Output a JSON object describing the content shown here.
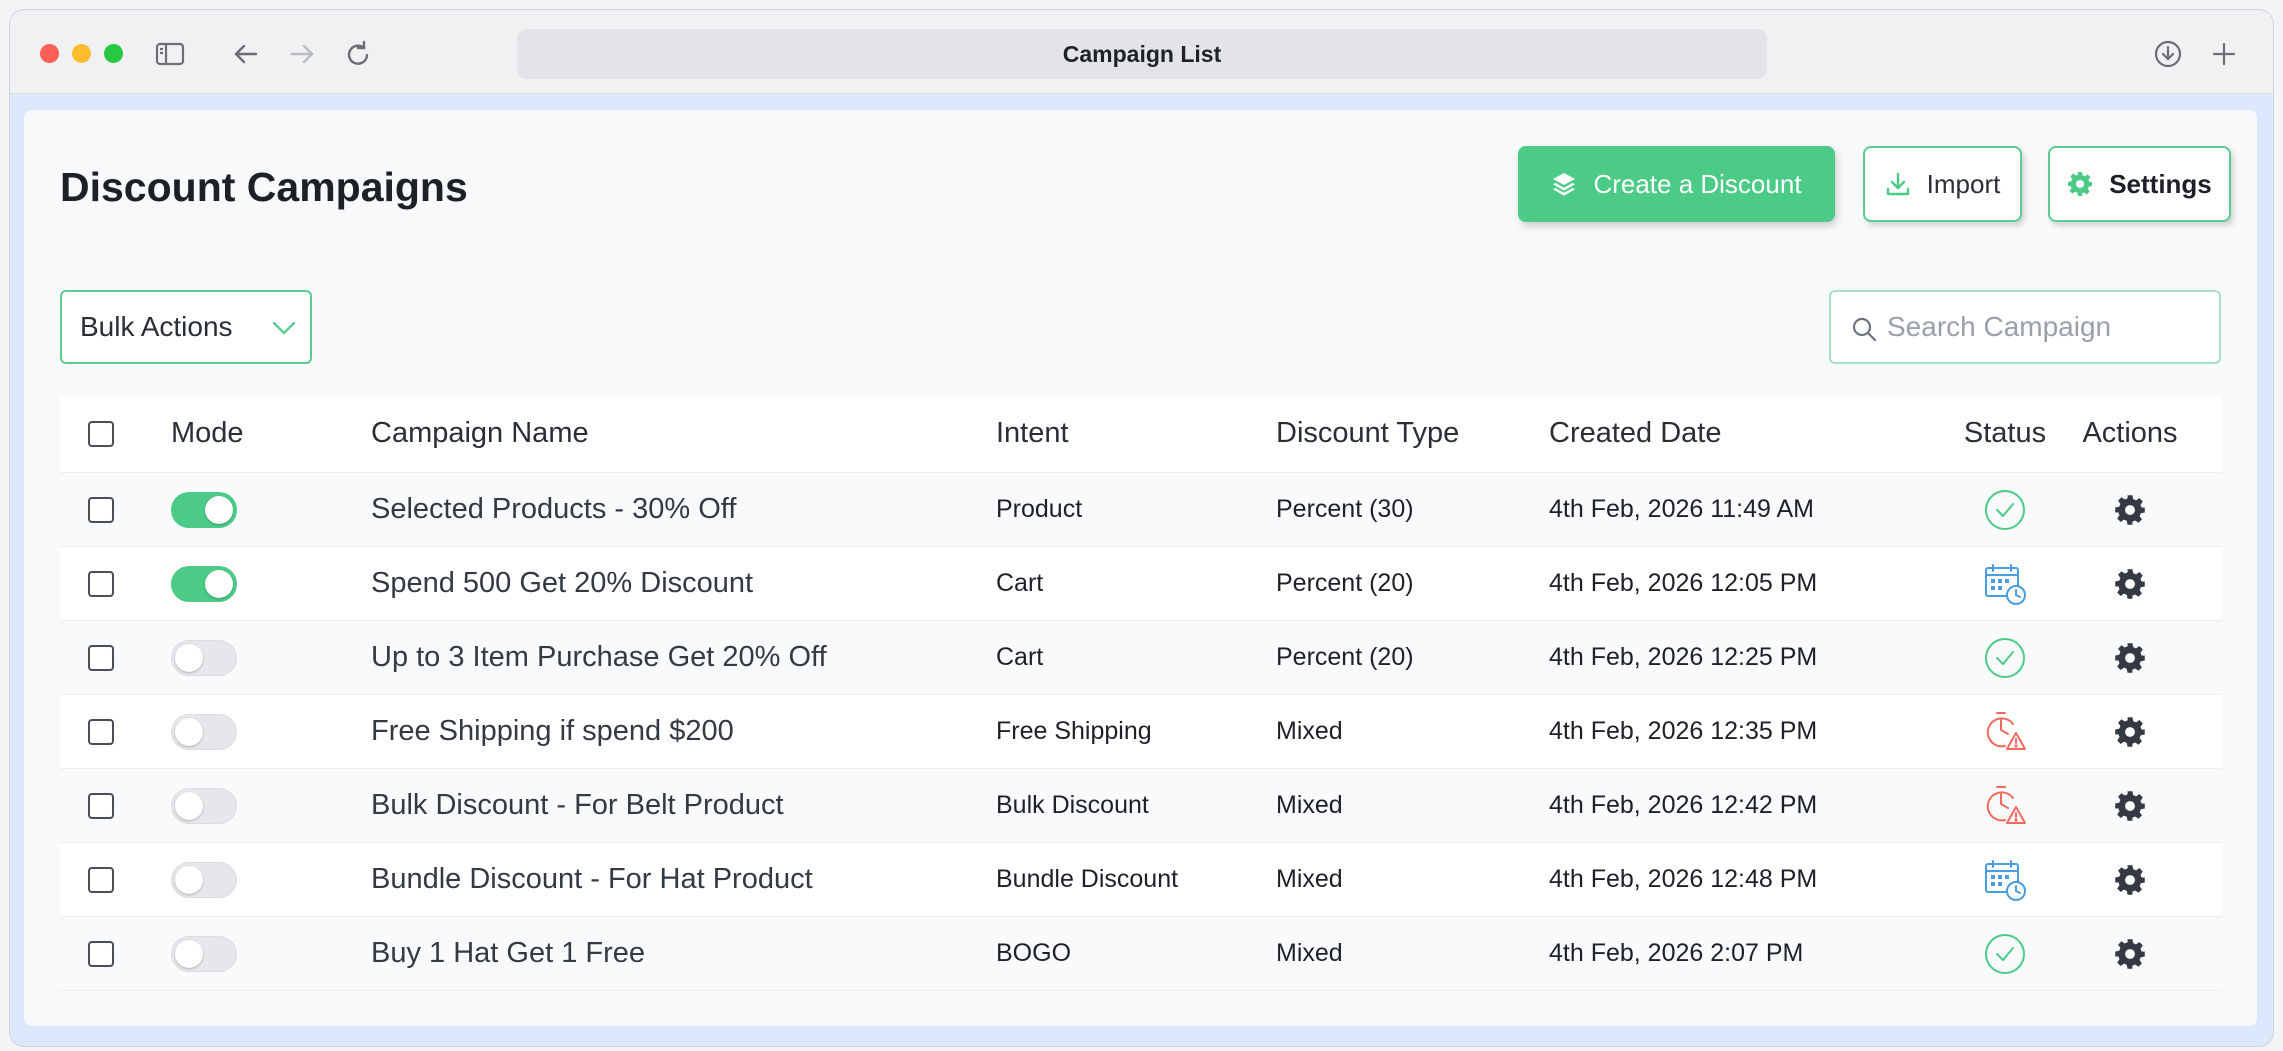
{
  "browser": {
    "title": "Campaign List"
  },
  "page": {
    "title": "Discount Campaigns",
    "buttons": {
      "create": "Create a Discount",
      "import": "Import",
      "settings": "Settings"
    },
    "bulk_actions": {
      "selected": "Bulk Actions"
    },
    "search": {
      "placeholder": "Search Campaign",
      "value": ""
    }
  },
  "table": {
    "columns": {
      "mode": "Mode",
      "name": "Campaign Name",
      "intent": "Intent",
      "discount_type": "Discount Type",
      "created_date": "Created Date",
      "status": "Status",
      "actions": "Actions"
    },
    "rows": [
      {
        "enabled": true,
        "name": "Selected Products - 30% Off",
        "intent": "Product",
        "discount_type": "Percent (30)",
        "created_date": "4th Feb, 2026 11:49 AM",
        "status": "active-check-icon"
      },
      {
        "enabled": true,
        "name": "Spend 500 Get 20% Discount",
        "intent": "Cart",
        "discount_type": "Percent (20)",
        "created_date": "4th Feb, 2026 12:05 PM",
        "status": "scheduled-calendar-icon"
      },
      {
        "enabled": false,
        "name": "Up to 3 Item Purchase Get 20% Off",
        "intent": "Cart",
        "discount_type": "Percent (20)",
        "created_date": "4th Feb, 2026 12:25 PM",
        "status": "active-check-icon"
      },
      {
        "enabled": false,
        "name": "Free Shipping if spend $200",
        "intent": "Free Shipping",
        "discount_type": "Mixed",
        "created_date": "4th Feb, 2026 12:35 PM",
        "status": "expired-clock-icon"
      },
      {
        "enabled": false,
        "name": "Bulk Discount - For Belt Product",
        "intent": "Bulk Discount",
        "discount_type": "Mixed",
        "created_date": "4th Feb, 2026 12:42 PM",
        "status": "expired-clock-icon"
      },
      {
        "enabled": false,
        "name": "Bundle Discount - For Hat Product",
        "intent": "Bundle Discount",
        "discount_type": "Mixed",
        "created_date": "4th Feb, 2026 12:48 PM",
        "status": "scheduled-calendar-icon"
      },
      {
        "enabled": false,
        "name": "Buy 1 Hat Get 1 Free",
        "intent": "BOGO",
        "discount_type": "Mixed",
        "created_date": "4th Feb, 2026 2:07 PM",
        "status": "active-check-icon"
      }
    ]
  },
  "colors": {
    "accent": "#4ccb87",
    "active": "#4ccb87",
    "scheduled": "#4a9de0",
    "expired": "#ef6b5b"
  }
}
